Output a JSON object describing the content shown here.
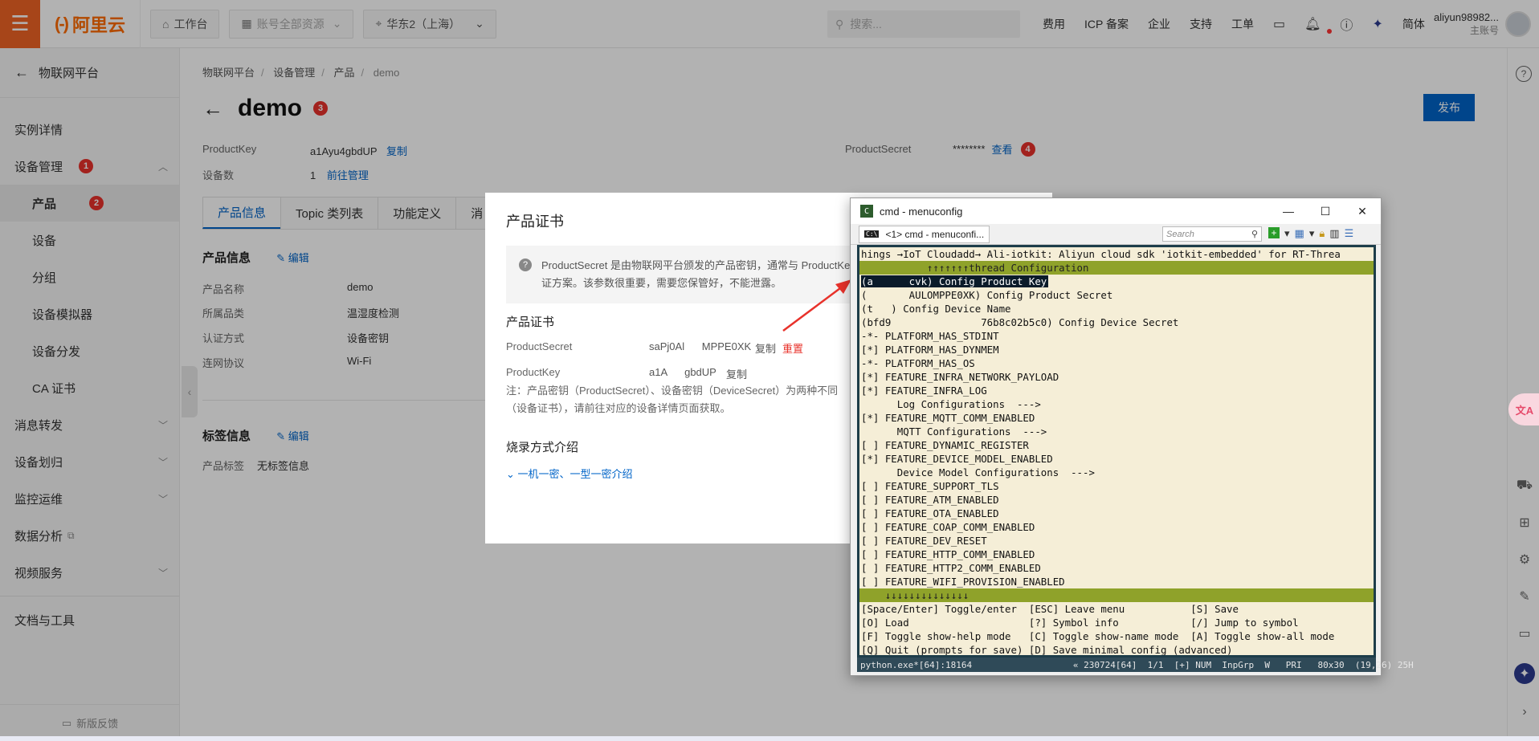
{
  "topbar": {
    "brand": "阿里云",
    "workspace": "工作台",
    "resource_group": "账号全部资源",
    "region": "华东2（上海）",
    "search_placeholder": "搜索...",
    "links": [
      "费用",
      "ICP 备案",
      "企业",
      "支持",
      "工单"
    ],
    "language": "简体",
    "account_name": "aliyun98982...",
    "account_role": "主账号"
  },
  "sidebar": {
    "back_label": "物联网平台",
    "items": [
      {
        "label": "实例详情"
      },
      {
        "label": "设备管理",
        "badge": "1"
      },
      {
        "label": "产品",
        "badge": "2"
      },
      {
        "label": "设备"
      },
      {
        "label": "分组"
      },
      {
        "label": "设备模拟器"
      },
      {
        "label": "设备分发"
      },
      {
        "label": "CA 证书"
      },
      {
        "label": "消息转发"
      },
      {
        "label": "设备划归"
      },
      {
        "label": "监控运维"
      },
      {
        "label": "数据分析"
      },
      {
        "label": "视频服务"
      },
      {
        "label": "文档与工具"
      }
    ],
    "feedback": "新版反馈"
  },
  "breadcrumb": [
    "物联网平台",
    "设备管理",
    "产品",
    "demo"
  ],
  "page": {
    "title": "demo",
    "title_badge": "3",
    "publish": "发布",
    "product_key_label": "ProductKey",
    "product_key_value": "a1Ayu4gbdUP",
    "copy": "复制",
    "device_count_label": "设备数",
    "device_count_value": "1",
    "manage_link": "前往管理",
    "product_secret_label": "ProductSecret",
    "product_secret_value": "********",
    "view_link": "查看",
    "secret_badge": "4"
  },
  "tabs": [
    "产品信息",
    "Topic 类列表",
    "功能定义",
    "消"
  ],
  "product_info": {
    "section_title": "产品信息",
    "edit": "编辑",
    "rows": [
      {
        "label": "产品名称",
        "value": "demo"
      },
      {
        "label": "所属品类",
        "value": "温湿度检测"
      },
      {
        "label": "认证方式",
        "value": "设备密钥"
      },
      {
        "label": "连网协议",
        "value": "Wi-Fi"
      }
    ]
  },
  "tag_info": {
    "section_title": "标签信息",
    "edit": "编辑",
    "label": "产品标签",
    "value": "无标签信息"
  },
  "modal": {
    "title": "产品证书",
    "info_line1": "ProductSecret 是由物联网平台颁发的产品密钥，通常与 ProductKe",
    "info_line2": "证方案。该参数很重要，需要您保管好，不能泄露。",
    "section": "产品证书",
    "secret_label": "ProductSecret",
    "secret_value": "saPj0Al      MPPE0XK",
    "copy": "复制",
    "reset": "重置",
    "key_label": "ProductKey",
    "key_value": "a1A      gbdUP",
    "note_line1": "注：产品密钥（ProductSecret）、设备密钥（DeviceSecret）为两种不同",
    "note_line2": "（设备证书），请前往对应的设备详情页面获取。",
    "burn_title": "烧录方式介绍",
    "burn_link": "一机一密、一型一密介绍"
  },
  "terminal": {
    "window_title": "cmd - menuconfig",
    "tab_label": "<1> cmd - menuconfi...",
    "search_placeholder": "Search",
    "lines": [
      "hings →IoT Cloudadd→ Ali-iotkit: Aliyun cloud sdk 'iotkit-embedded' for RT-Threa",
      "           ↑↑↑↑↑↑↑thread Configuration",
      "(a      cvk) Config Product Key",
      "(       AULOMPPE0XK) Config Product Secret",
      "(t   ) Config Device Name",
      "(bfd9               76b8c02b5c0) Config Device Secret",
      "-*- PLATFORM_HAS_STDINT",
      "[*] PLATFORM_HAS_DYNMEM",
      "-*- PLATFORM_HAS_OS",
      "[*] FEATURE_INFRA_NETWORK_PAYLOAD",
      "[*] FEATURE_INFRA_LOG",
      "      Log Configurations  --->",
      "[*] FEATURE_MQTT_COMM_ENABLED",
      "      MQTT Configurations  --->",
      "[ ] FEATURE_DYNAMIC_REGISTER",
      "[*] FEATURE_DEVICE_MODEL_ENABLED",
      "      Device Model Configurations  --->",
      "[ ] FEATURE_SUPPORT_TLS",
      "[ ] FEATURE_ATM_ENABLED",
      "[ ] FEATURE_OTA_ENABLED",
      "[ ] FEATURE_COAP_COMM_ENABLED",
      "[ ] FEATURE_DEV_RESET",
      "[ ] FEATURE_HTTP_COMM_ENABLED",
      "[ ] FEATURE_HTTP2_COMM_ENABLED",
      "[ ] FEATURE_WIFI_PROVISION_ENABLED",
      "    ↓↓↓↓↓↓↓↓↓↓↓↓↓↓",
      "[Space/Enter] Toggle/enter  [ESC] Leave menu           [S] Save",
      "[O] Load                    [?] Symbol info            [/] Jump to symbol",
      "[F] Toggle show-help mode   [C] Toggle show-name mode  [A] Toggle show-all mode",
      "[Q] Quit (prompts for save) [D] Save minimal config (advanced)"
    ],
    "status": "python.exe*[64]:18164                   « 230724[64]  1/1  [+] NUM  InpGrp  W   PRI   80x30  (19,26) 25H"
  }
}
